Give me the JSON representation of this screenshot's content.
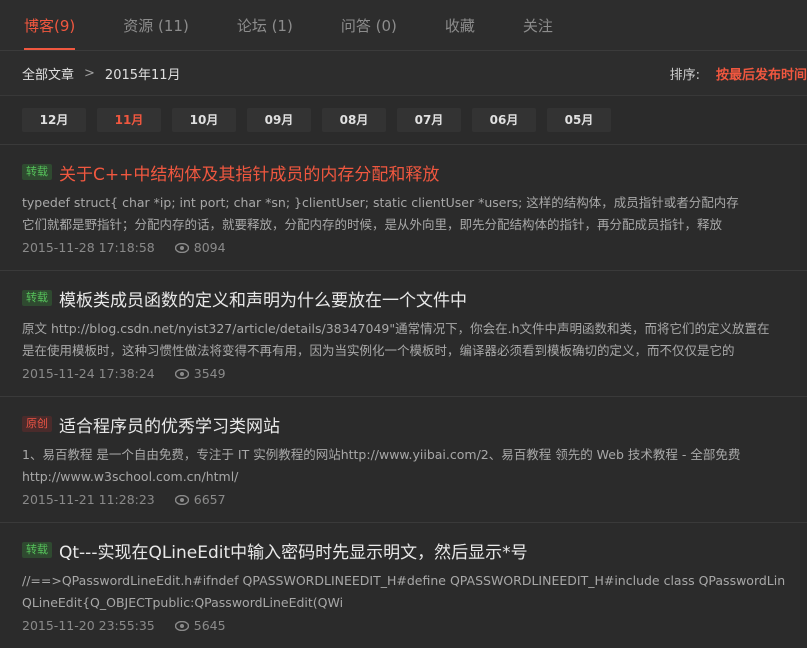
{
  "tabs": [
    {
      "label": "博客(9)",
      "active": true
    },
    {
      "label": "资源 (11)",
      "active": false
    },
    {
      "label": "论坛 (1)",
      "active": false
    },
    {
      "label": "问答 (0)",
      "active": false
    },
    {
      "label": "收藏",
      "active": false
    },
    {
      "label": "关注",
      "active": false
    }
  ],
  "breadcrumb": {
    "root": "全部文章",
    "sep": ">",
    "current": "2015年11月"
  },
  "sort": {
    "label": "排序:",
    "value": "按最后发布时间"
  },
  "months": [
    {
      "label": "12月",
      "active": false
    },
    {
      "label": "11月",
      "active": true
    },
    {
      "label": "10月",
      "active": false
    },
    {
      "label": "09月",
      "active": false
    },
    {
      "label": "08月",
      "active": false
    },
    {
      "label": "07月",
      "active": false
    },
    {
      "label": "06月",
      "active": false
    },
    {
      "label": "05月",
      "active": false
    }
  ],
  "articles": [
    {
      "badge": "转载",
      "badge_type": "repost",
      "title": "关于C++中结构体及其指针成员的内存分配和释放",
      "hot": true,
      "summary1": "typedef struct{    char *ip;    int port;    char *sn;  }clientUser;  static clientUser *users;       这样的结构体，成员指针或者分配内存",
      "summary2": "它们就都是野指针；分配内存的话，就要释放，分配内存的时候，是从外向里，即先分配结构体的指针，再分配成员指针，释放",
      "date": "2015-11-28 17:18:58",
      "views": "8094"
    },
    {
      "badge": "转载",
      "badge_type": "repost",
      "title": "模板类成员函数的定义和声明为什么要放在一个文件中",
      "hot": false,
      "summary1": "原文  http://blog.csdn.net/nyist327/article/details/38347049\"通常情况下，你会在.h文件中声明函数和类，而将它们的定义放置在",
      "summary2": "是在使用模板时，这种习惯性做法将变得不再有用，因为当实例化一个模板时，编译器必须看到模板确切的定义，而不仅仅是它的",
      "date": "2015-11-24 17:38:24",
      "views": "3549"
    },
    {
      "badge": "原创",
      "badge_type": "original",
      "title": "适合程序员的优秀学习类网站",
      "hot": false,
      "summary1": "1、易百教程 是一个自由免费，专注于 IT 实例教程的网站http://www.yiibai.com/2、易百教程 领先的 Web 技术教程 - 全部免费",
      "summary2": "http://www.w3school.com.cn/html/",
      "date": "2015-11-21 11:28:23",
      "views": "6657"
    },
    {
      "badge": "转载",
      "badge_type": "repost",
      "title": "Qt---实现在QLineEdit中输入密码时先显示明文，然后显示*号",
      "hot": false,
      "summary1": "//==>QPasswordLineEdit.h#ifndef QPASSWORDLINEEDIT_H#define QPASSWORDLINEEDIT_H#include class QPasswordLin",
      "summary2": "QLineEdit{Q_OBJECTpublic:QPasswordLineEdit(QWi",
      "date": "2015-11-20 23:55:35",
      "views": "5645"
    }
  ]
}
